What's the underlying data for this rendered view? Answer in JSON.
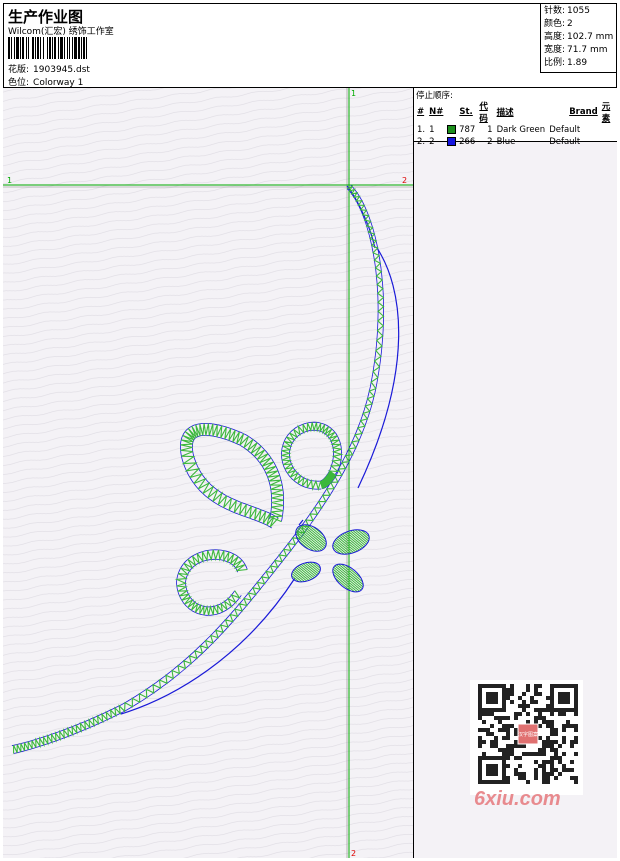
{
  "header": {
    "title": "生产作业图",
    "subtitle": "Wilcom(汇宏) 绣饰工作室",
    "pattern_label": "花版:",
    "pattern_value": "1903945.dst",
    "colorway_label": "色位:",
    "colorway_value": "Colorway 1"
  },
  "stats": {
    "stitches_label": "针数:",
    "stitches_value": "1055",
    "colors_label": "颜色:",
    "colors_value": "2",
    "height_label": "高度:",
    "height_value": "102.7 mm",
    "width_label": "宽度:",
    "width_value": "71.7 mm",
    "ratio_label": "比例:",
    "ratio_value": "1.89"
  },
  "stop_sequence": {
    "title": "停止顺序:",
    "columns": [
      "#",
      "N#",
      "St.",
      "代码",
      "描述",
      "Brand",
      "元素"
    ],
    "rows": [
      {
        "num": "1.",
        "n": "1",
        "color": "#1d8f1d",
        "st": "787",
        "code": "1",
        "desc": "Dark Green",
        "brand": "Default",
        "element": ""
      },
      {
        "num": "2.",
        "n": "2",
        "color": "#1515e0",
        "st": "266",
        "code": "2",
        "desc": "Blue",
        "brand": "Default",
        "element": ""
      }
    ]
  },
  "crosshair": {
    "top_label": "1",
    "bottom_label": "2",
    "left_label": "1",
    "right_label": "2",
    "color": "#00aa00",
    "red_color": "#dd0000"
  },
  "design_colors": {
    "green": "#3cb83c",
    "blue": "#1a1ad8"
  },
  "watermark": {
    "text": "6xiu.com",
    "qr_center": "汉字图案"
  }
}
